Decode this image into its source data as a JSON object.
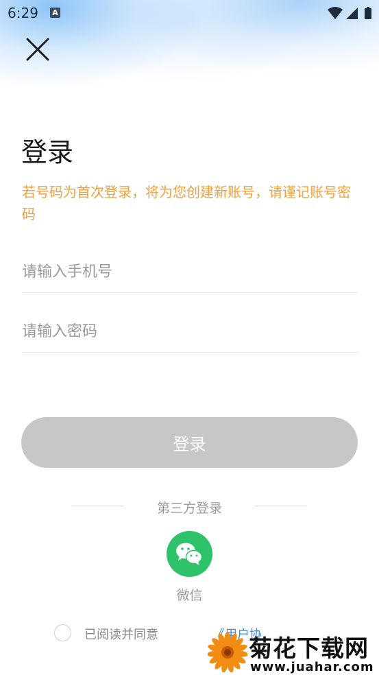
{
  "status_bar": {
    "time": "6:29",
    "app_notification_icon": "A",
    "icons": [
      "wifi-icon",
      "signal-icon",
      "battery-icon"
    ]
  },
  "header": {
    "close_icon": "close-icon"
  },
  "main": {
    "title": "登录",
    "hint": "若号码为首次登录，将为您创建新账号，请谨记账号密码",
    "phone_input": {
      "placeholder": "请输入手机号",
      "value": ""
    },
    "password_input": {
      "placeholder": "请输入密码",
      "value": ""
    },
    "login_button_label": "登录"
  },
  "third_party": {
    "label": "第三方登录",
    "wechat_label": "微信"
  },
  "agreement": {
    "text": "已阅读并同意",
    "link_text": "《用户协"
  },
  "watermark": {
    "title": "菊花下载网",
    "url": "www.juahar.com"
  },
  "colors": {
    "hint": "#f0a03c",
    "button_disabled": "#c7c7c9",
    "wechat_green": "#2ec36a",
    "link": "#3b8ddb"
  }
}
